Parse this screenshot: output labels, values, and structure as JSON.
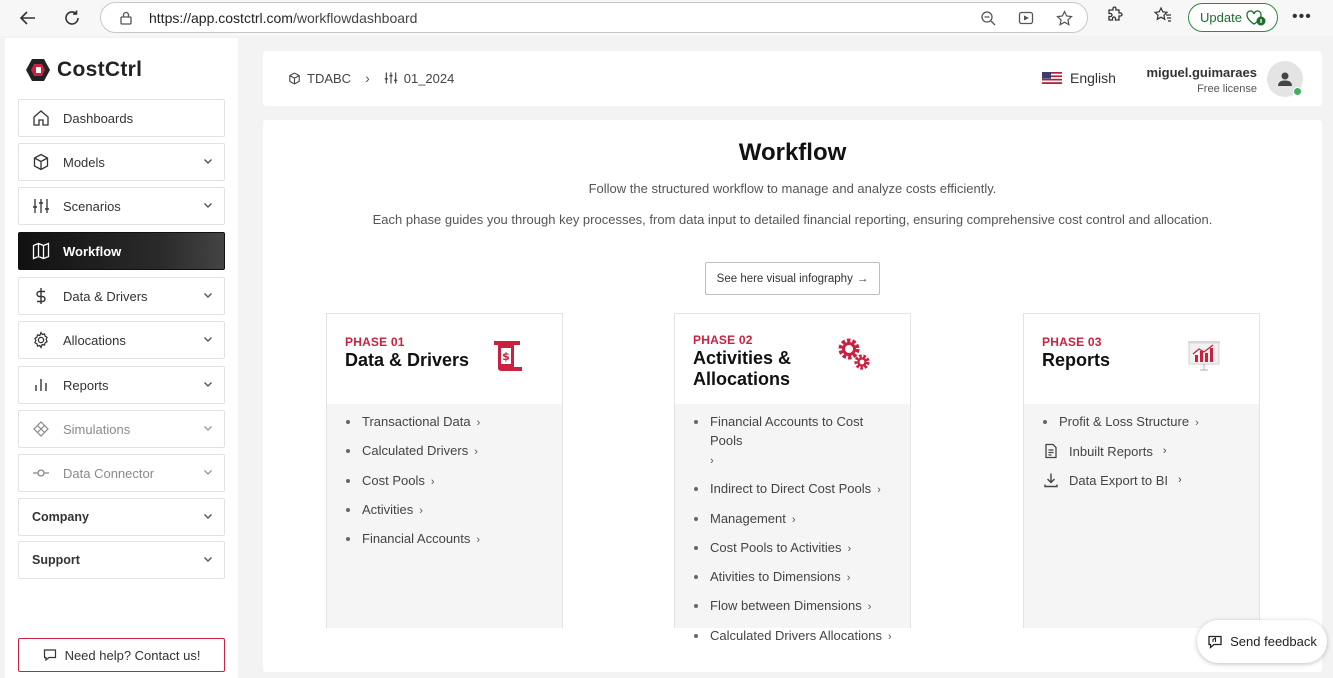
{
  "browser": {
    "url_host": "https://app.costctrl.com",
    "url_path": "/workflowdashboard",
    "update_label": "Update"
  },
  "sidebar": {
    "logo": "CostCtrl",
    "items": [
      {
        "label": "Dashboards",
        "icon": "home-icon",
        "state": "normal"
      },
      {
        "label": "Models",
        "icon": "cube-icon",
        "state": "normal"
      },
      {
        "label": "Scenarios",
        "icon": "sliders-icon",
        "state": "normal"
      },
      {
        "label": "Workflow",
        "icon": "map-icon",
        "state": "active"
      },
      {
        "label": "Data & Drivers",
        "icon": "dollar-icon",
        "state": "normal"
      },
      {
        "label": "Allocations",
        "icon": "gear-icon",
        "state": "normal"
      },
      {
        "label": "Reports",
        "icon": "bar-chart-icon",
        "state": "normal"
      },
      {
        "label": "Simulations",
        "icon": "simulation-icon",
        "state": "disabled"
      },
      {
        "label": "Data Connector",
        "icon": "connector-icon",
        "state": "disabled"
      },
      {
        "label": "Company",
        "icon": "",
        "state": "plain"
      },
      {
        "label": "Support",
        "icon": "",
        "state": "plain"
      }
    ],
    "help_label": "Need help? Contact us!"
  },
  "header": {
    "breadcrumb_model": "TDABC",
    "breadcrumb_scenario": "01_2024",
    "language": "English",
    "username": "miguel.guimaraes",
    "license": "Free license"
  },
  "main": {
    "title": "Workflow",
    "subtitle1": "Follow the structured workflow to manage and analyze costs efficiently.",
    "subtitle2": "Each phase guides you through key processes, from data input to detailed financial reporting, ensuring comprehensive cost control and allocation.",
    "infographic_label": "See here visual infography",
    "phases": [
      {
        "label": "PHASE 01",
        "title": "Data & Drivers",
        "items": [
          "Transactional Data",
          "Calculated Drivers",
          "Cost Pools",
          "Activities",
          "Financial Accounts"
        ]
      },
      {
        "label": "PHASE 02",
        "title_line1": "Activities &",
        "title_line2": "Allocations",
        "items": [
          "Financial Accounts to Cost Pools",
          "Indirect to Direct Cost Pools",
          "Management",
          "Cost Pools to Activities",
          "Ativities to Dimensions",
          "Flow between Dimensions",
          "Calculated Drivers Allocations"
        ]
      },
      {
        "label": "PHASE 03",
        "title": "Reports",
        "items": [
          "Profit & Loss Structure"
        ],
        "links": [
          "Inbuilt Reports",
          "Data Export to BI"
        ]
      }
    ]
  },
  "feedback_label": "Send feedback",
  "colors": {
    "accent": "#c9213f",
    "active_nav": "#111111",
    "update_green": "#2d8a3e"
  }
}
